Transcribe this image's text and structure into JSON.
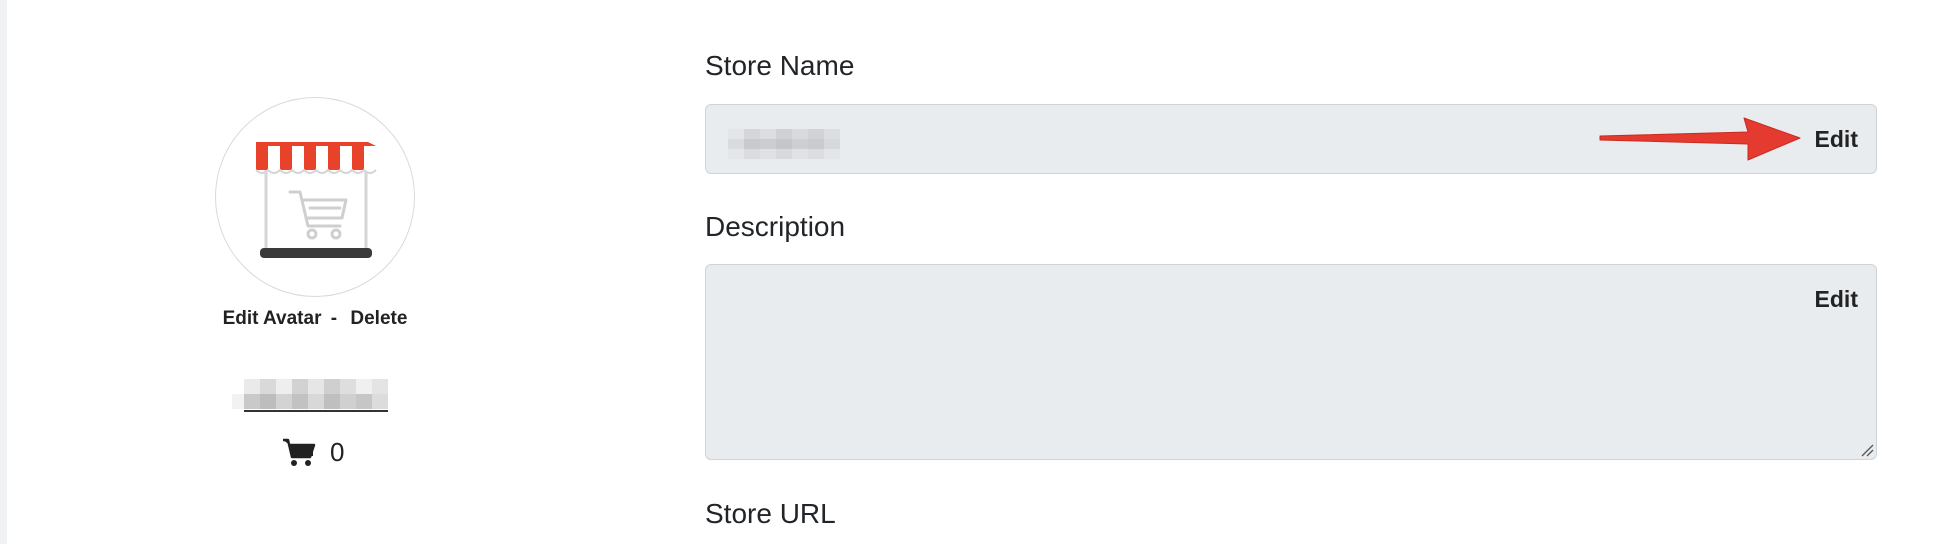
{
  "profile": {
    "avatar_icon": "storefront-cart-icon",
    "edit_avatar_label": "Edit Avatar",
    "separator": "-",
    "delete_label": "Delete",
    "cart_icon": "shopping-cart-icon",
    "cart_count": "0"
  },
  "form": {
    "store_name": {
      "label": "Store Name",
      "edit_label": "Edit"
    },
    "description": {
      "label": "Description",
      "edit_label": "Edit"
    },
    "store_url": {
      "label": "Store URL"
    }
  },
  "colors": {
    "field_background": "#e9ecef",
    "awning_red": "#e8432a",
    "annotation_arrow": "#e53a2f"
  }
}
